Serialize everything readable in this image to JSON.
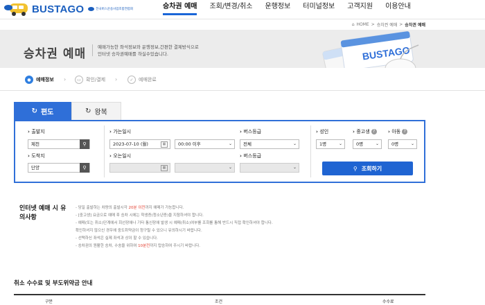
{
  "header": {
    "logo_text": "BUSTAGO",
    "logo_sub": "전국버스운송사업조합연합회",
    "nav": [
      "승차권 예매",
      "조회/변경/취소",
      "운행정보",
      "터미널정보",
      "고객지원",
      "이용안내"
    ],
    "active_nav": 0
  },
  "breadcrumb": {
    "home": "HOME",
    "sep": ">",
    "mid": "승차권 예매",
    "current": "승차권 예매"
  },
  "hero": {
    "title": "승차권 예매",
    "desc1": "예매가능한 좌석정보와 운행정보,간편한 결제방식으로",
    "desc2": "인터넷 승차권예매를 하실수있습니다.",
    "ticket_text": "BUSTAGO"
  },
  "steps": [
    {
      "label": "예매정보",
      "icon": "pin-icon"
    },
    {
      "label": "확인/결제",
      "icon": "card-icon"
    },
    {
      "label": "예매완료",
      "icon": "check-icon"
    }
  ],
  "tabs": [
    {
      "label": "편도",
      "icon": "refresh-icon"
    },
    {
      "label": "왕복",
      "icon": "refresh-icon"
    }
  ],
  "form": {
    "depart_label": "출발지",
    "depart_value": "제천",
    "arrive_label": "도착지",
    "arrive_value": "단양",
    "go_date_label": "가는일시",
    "go_date_value": "2023-07-10 (월)",
    "go_time_value": "00:00 이후",
    "return_date_label": "오는일시",
    "grade_label": "버스등급",
    "grade_value": "전체",
    "grade2_label": "버스등급",
    "adult_label": "성인",
    "adult_value": "1명",
    "student_label": "중고생",
    "student_value": "0명",
    "child_label": "아동",
    "child_value": "0명",
    "search_button": "조회하기"
  },
  "notice": {
    "title": "인터넷 예매 시 유의사항",
    "items": [
      {
        "pre": "- 당일 출발하는 차량의 출발시각 ",
        "red": "20분 이전",
        "post": "까지 예매가 가능합니다."
      },
      {
        "pre": "- [중고생] 요금으로 예매 후 승차 시에는 학생증(청소년증)을 지참하셔야 합니다.",
        "red": "",
        "post": ""
      },
      {
        "pre": "- 예매(또는 취소)단계에서 회선장애나 기타 통신장애 발생 시 예매(취소)여부를 조회를 통해 반드시 직접 확인하셔야 합니다.",
        "red": "",
        "post": ""
      },
      {
        "pre": "  확인하셔지 않으신 경우에 중도취약금이 청구될 수 있으니 유의하시기 바랍니다.",
        "red": "",
        "post": ""
      },
      {
        "pre": "- 선택하신 좌석은 실제 좌석과 상이 할 수 있습니다.",
        "red": "",
        "post": ""
      },
      {
        "pre": "- 승차권의 원활한 승차, 수송을 위하여 ",
        "red": "10분전",
        "post": "까지 탑승하여 주시기 바랍니다."
      }
    ]
  },
  "fee": {
    "title": "취소 수수료 및 부도위약금 안내",
    "cols": [
      "구분",
      "조건",
      "수수료"
    ]
  },
  "colors": {
    "accent": "#2f6fd8",
    "red": "#e23b2c",
    "brand": "#1b5fbf"
  }
}
